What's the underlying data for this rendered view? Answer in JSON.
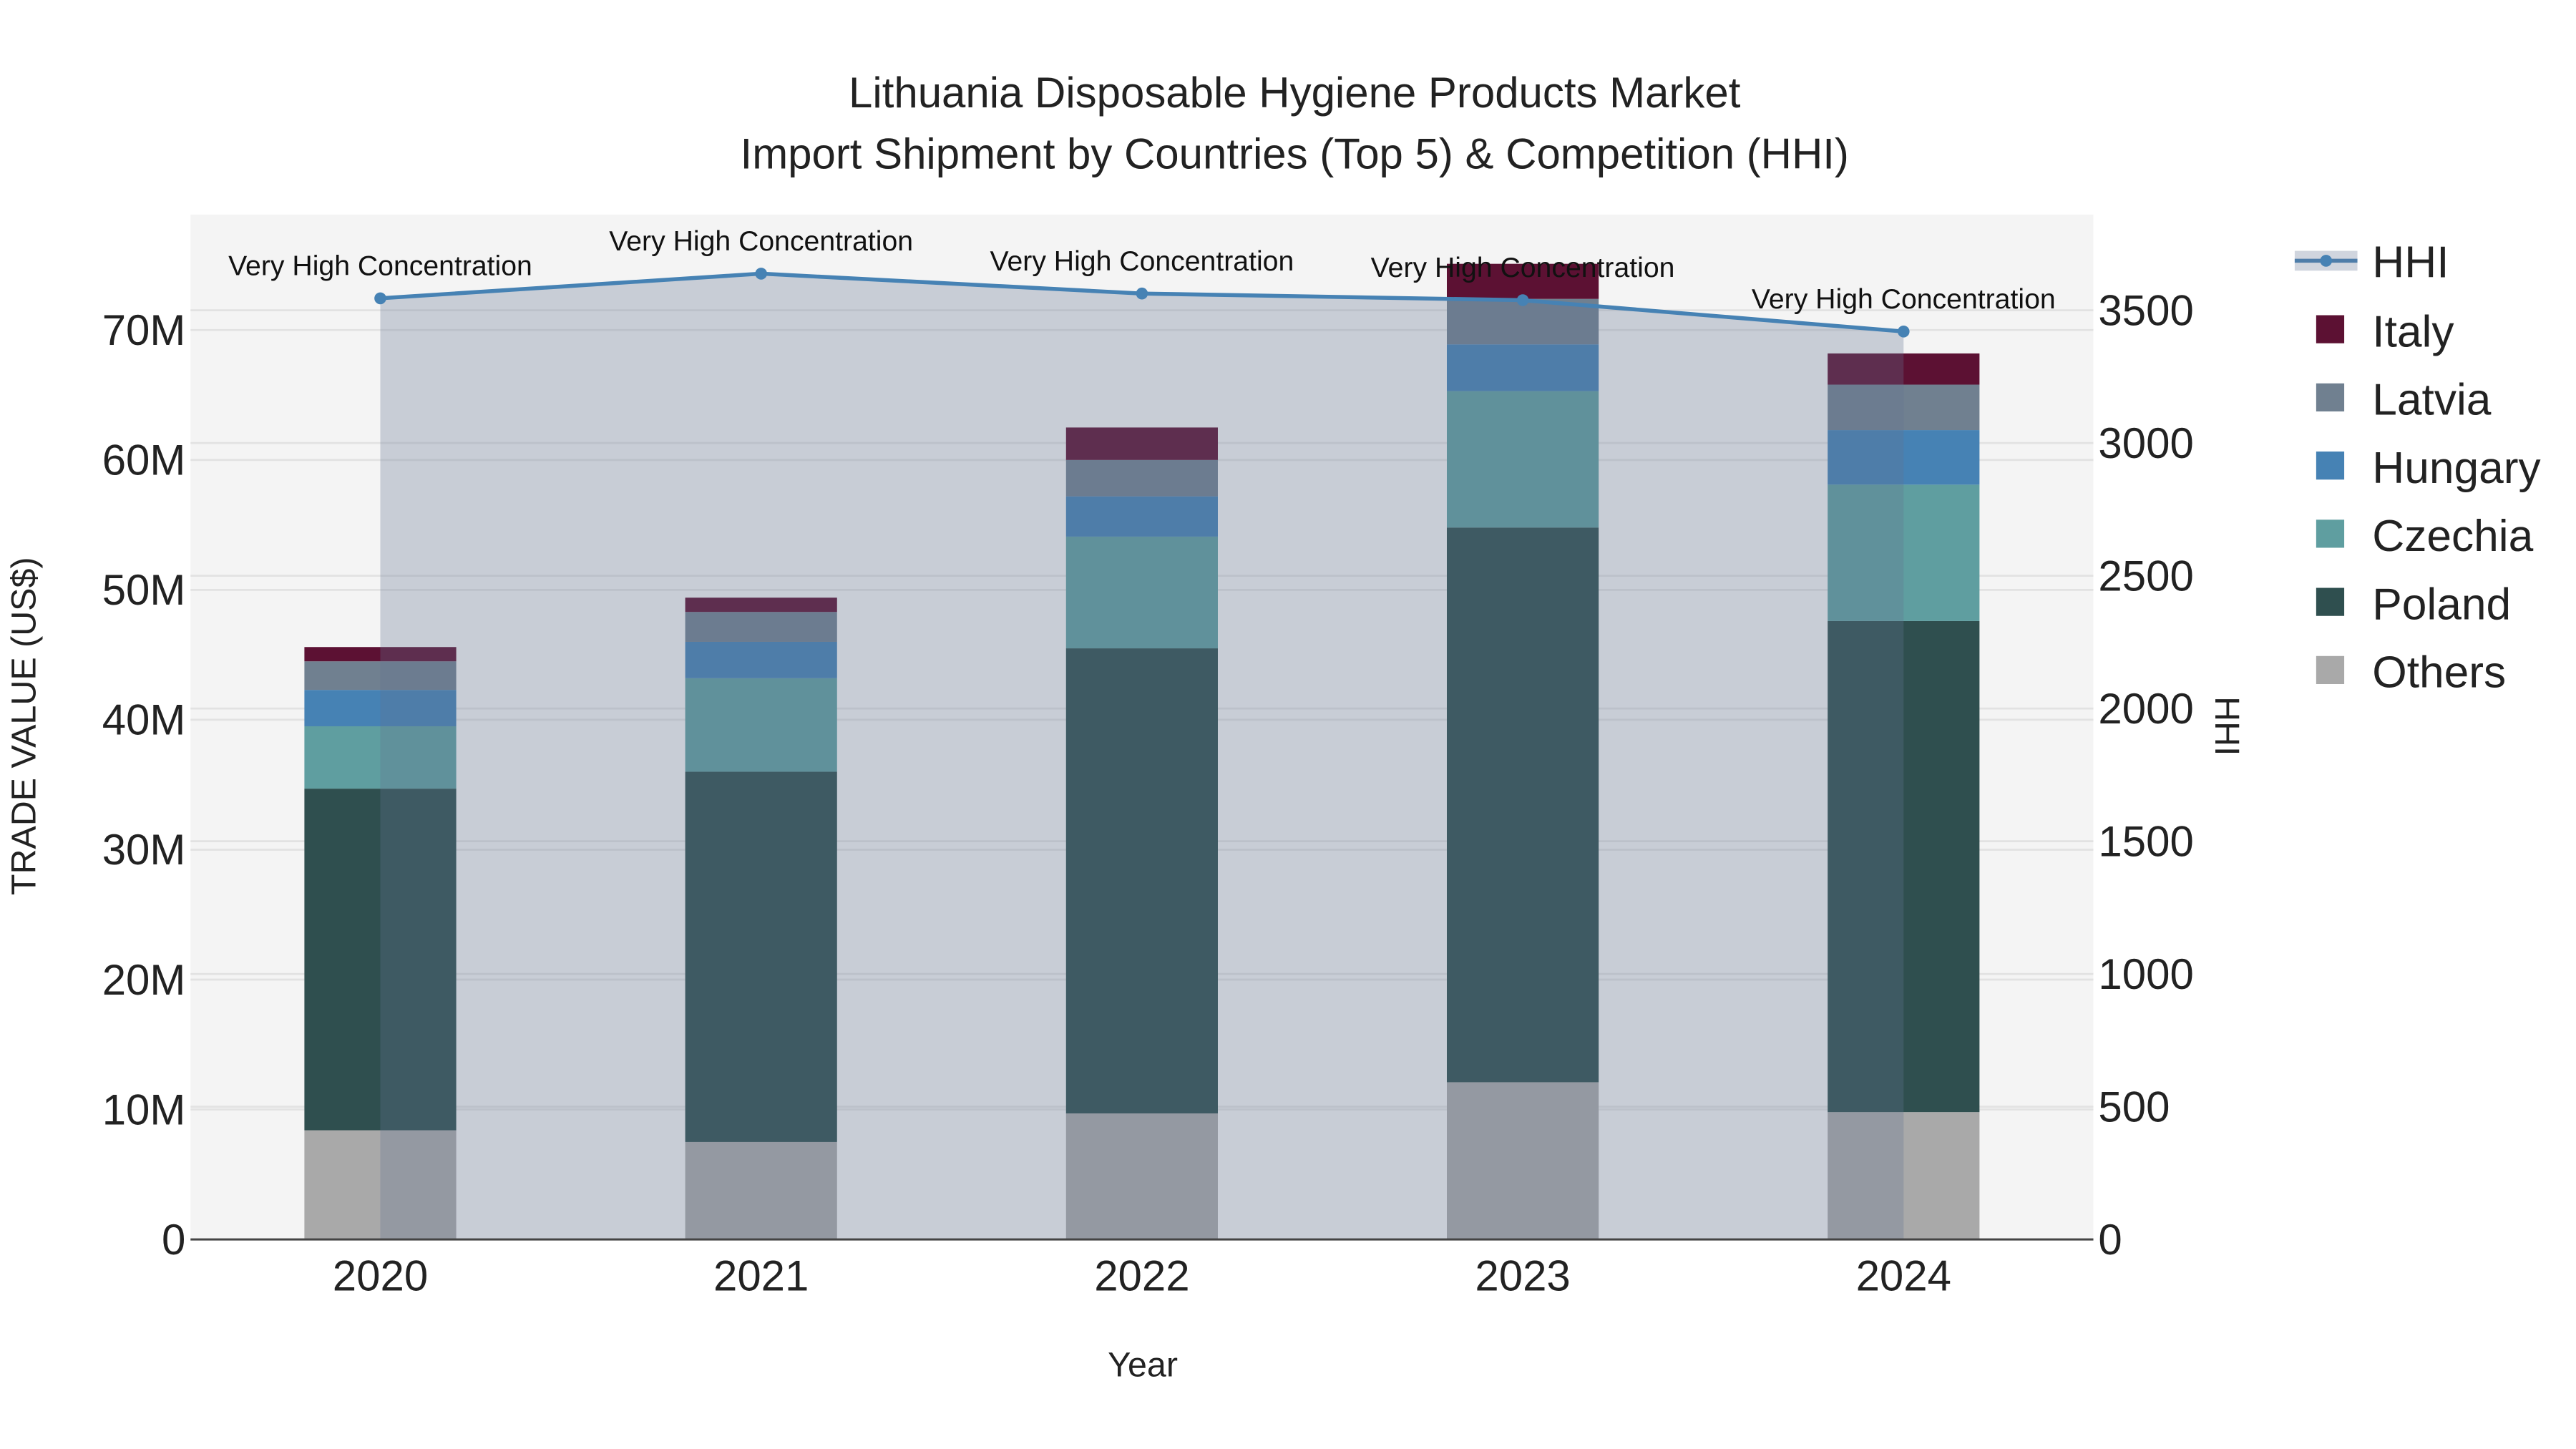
{
  "chart_data": {
    "type": "bar",
    "title_line1": "Lithuania Disposable Hygiene Products Market",
    "title_line2": "Import Shipment by Countries (Top 5) & Competition (HHI)",
    "xlabel": "Year",
    "ylabel": "TRADE VALUE (US$)",
    "y2label": "HHI",
    "categories": [
      "2020",
      "2021",
      "2022",
      "2023",
      "2024"
    ],
    "ylim": [
      0,
      78000000
    ],
    "y2lim": [
      0,
      3850
    ],
    "yticks": [
      {
        "v": 0,
        "label": "0"
      },
      {
        "v": 10000000,
        "label": "10M"
      },
      {
        "v": 20000000,
        "label": "20M"
      },
      {
        "v": 30000000,
        "label": "30M"
      },
      {
        "v": 40000000,
        "label": "40M"
      },
      {
        "v": 50000000,
        "label": "50M"
      },
      {
        "v": 60000000,
        "label": "60M"
      },
      {
        "v": 70000000,
        "label": "70M"
      }
    ],
    "y2ticks": [
      {
        "v": 0,
        "label": "0"
      },
      {
        "v": 500,
        "label": "500"
      },
      {
        "v": 1000,
        "label": "1000"
      },
      {
        "v": 1500,
        "label": "1500"
      },
      {
        "v": 2000,
        "label": "2000"
      },
      {
        "v": 2500,
        "label": "2500"
      },
      {
        "v": 3000,
        "label": "3000"
      },
      {
        "v": 3500,
        "label": "3500"
      }
    ],
    "grid": true,
    "legend_position": "right",
    "stacked": true,
    "series": [
      {
        "name": "Others",
        "color": "#a9a9a9",
        "values": [
          8400000,
          7500000,
          9700000,
          12100000,
          9800000
        ]
      },
      {
        "name": "Poland",
        "color": "#2f4f4f",
        "values": [
          26300000,
          28500000,
          35800000,
          42700000,
          37800000
        ]
      },
      {
        "name": "Czechia",
        "color": "#5f9ea0",
        "values": [
          4800000,
          7200000,
          8600000,
          10500000,
          10500000
        ]
      },
      {
        "name": "Hungary",
        "color": "#4682b4",
        "values": [
          2800000,
          2800000,
          3100000,
          3600000,
          4200000
        ]
      },
      {
        "name": "Latvia",
        "color": "#708090",
        "values": [
          2200000,
          2300000,
          2800000,
          3500000,
          3500000
        ]
      },
      {
        "name": "Italy",
        "color": "#5c1133",
        "values": [
          1100000,
          1100000,
          2500000,
          2700000,
          2400000
        ]
      }
    ],
    "hhi": {
      "name": "HHI",
      "color": "#4682b4",
      "values": [
        3545,
        3638,
        3563,
        3538,
        3420
      ],
      "annotations": [
        "Very High Concentration",
        "Very High Concentration",
        "Very High Concentration",
        "Very High Concentration",
        "Very High Concentration"
      ]
    }
  }
}
